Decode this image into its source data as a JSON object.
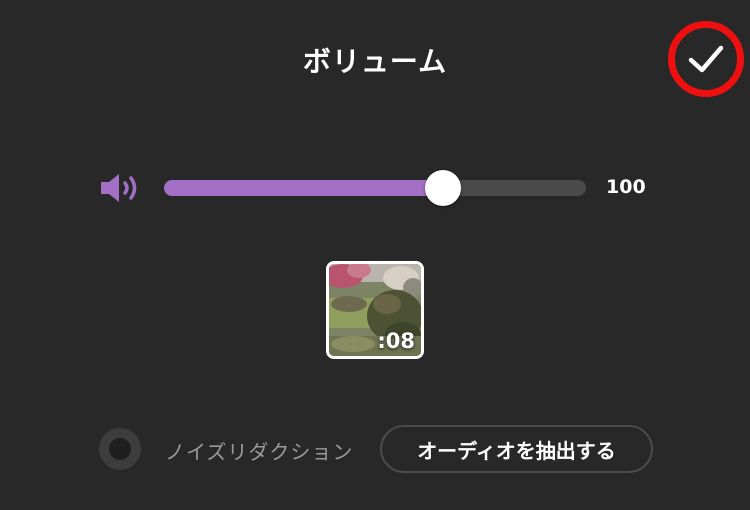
{
  "header": {
    "title": "ボリューム",
    "confirm_icon": "checkmark-icon",
    "highlight_color": "#ee1010"
  },
  "volume": {
    "icon": "speaker-icon",
    "value": 100,
    "value_label": "100",
    "slider_fraction": 0.66,
    "accent_color": "#a36fc4"
  },
  "clip": {
    "duration": ":08"
  },
  "options": {
    "noise_reduction_label": "ノイズリダクション",
    "noise_reduction_enabled": false,
    "extract_audio_label": "オーディオを抽出する"
  }
}
